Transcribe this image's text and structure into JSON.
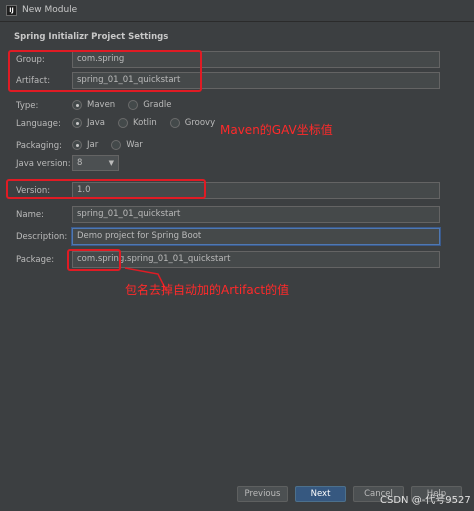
{
  "window": {
    "title": "New Module",
    "icon": "IJ"
  },
  "section_title": "Spring Initializr Project Settings",
  "fields": {
    "group": {
      "label": "Group:",
      "value": "com.spring"
    },
    "artifact": {
      "label": "Artifact:",
      "value": "spring_01_01_quickstart"
    },
    "version": {
      "label": "Version:",
      "value": "1.0"
    },
    "name": {
      "label": "Name:",
      "value": "spring_01_01_quickstart"
    },
    "description": {
      "label": "Description:",
      "value": "Demo project for Spring Boot"
    },
    "package": {
      "label": "Package:",
      "value": "com.spring.spring_01_01_quickstart"
    }
  },
  "type": {
    "label": "Type:",
    "options": [
      "Maven",
      "Gradle"
    ],
    "selected": "Maven"
  },
  "language": {
    "label": "Language:",
    "options": [
      "Java",
      "Kotlin",
      "Groovy"
    ],
    "selected": "Java"
  },
  "packaging": {
    "label": "Packaging:",
    "options": [
      "Jar",
      "War"
    ],
    "selected": "Jar"
  },
  "java_version": {
    "label": "Java version:",
    "value": "8"
  },
  "annotations": {
    "gav": "Maven的GAV坐标值",
    "package_note": "包名去掉自动加的Artifact的值"
  },
  "buttons": {
    "previous": "Previous",
    "next": "Next",
    "cancel": "Cancel",
    "help": "Help"
  },
  "watermark": "CSDN @-代号9527",
  "colors": {
    "annotation_red": "#e01b24",
    "primary_button": "#365880",
    "background": "#3c3f41"
  }
}
